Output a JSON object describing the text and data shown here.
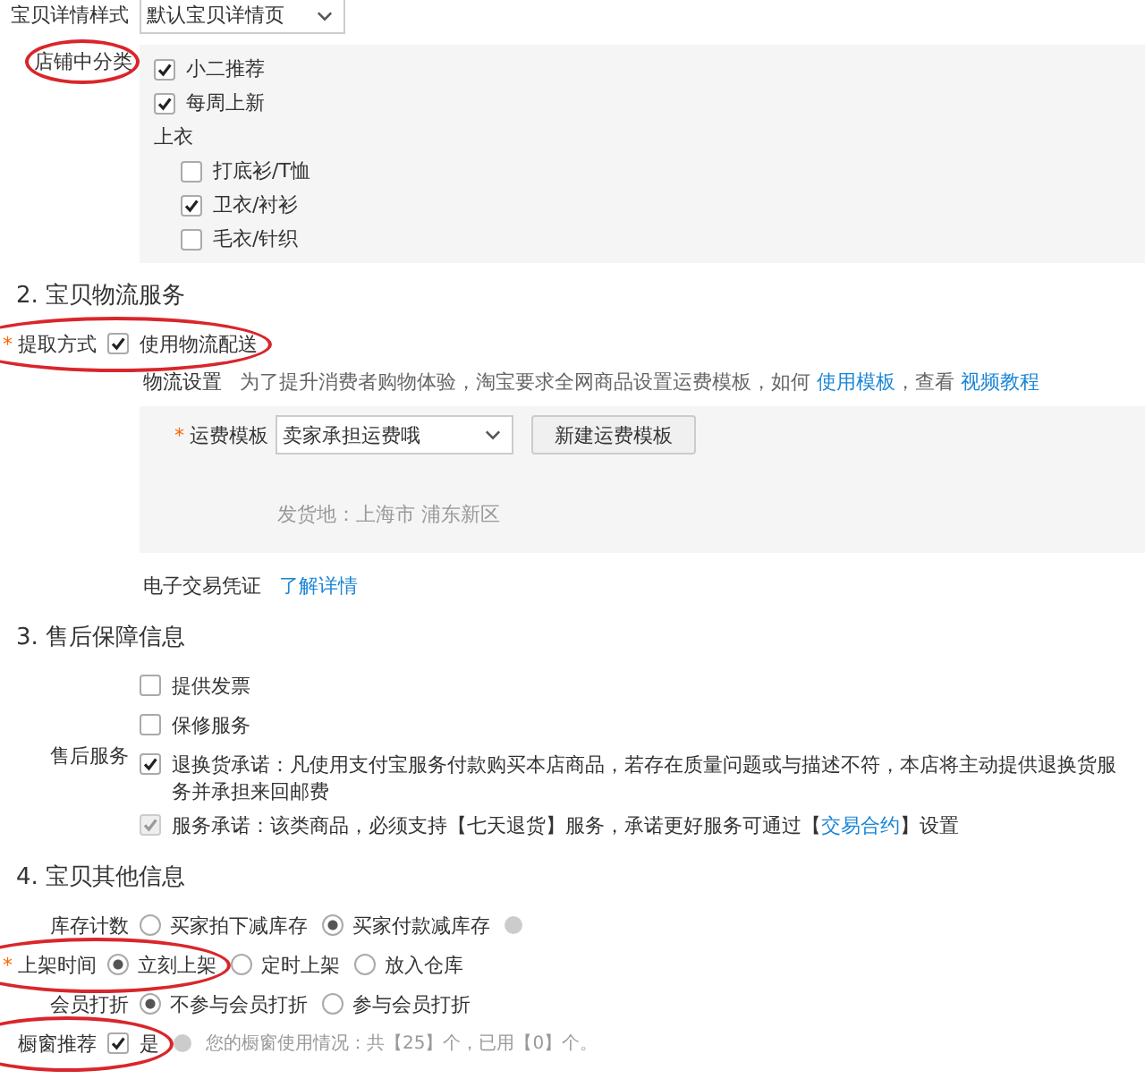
{
  "detail_style": {
    "label": "宝贝详情样式",
    "value": "默认宝贝详情页"
  },
  "shop_category": {
    "label": "店铺中分类",
    "circled": true,
    "items": [
      {
        "kind": "check",
        "label": "小二推荐",
        "checked": true
      },
      {
        "kind": "check",
        "label": "每周上新",
        "checked": true
      },
      {
        "kind": "group",
        "label": "上衣",
        "children": [
          {
            "kind": "check",
            "label": "打底衫/T恤",
            "checked": false
          },
          {
            "kind": "check",
            "label": "卫衣/衬衫",
            "checked": true
          },
          {
            "kind": "check",
            "label": "毛衣/针织",
            "checked": false
          }
        ]
      }
    ]
  },
  "sections": [
    {
      "heading": "2. 宝贝物流服务",
      "rows": [
        {
          "kind": "checks",
          "label": "提取方式",
          "required_mark": "*",
          "circled": true,
          "options": [
            {
              "label": "使用物流配送",
              "checked": true,
              "disabled": false
            }
          ]
        },
        {
          "kind": "note",
          "label": "物流设置",
          "parts": [
            {
              "text": "为了提升消费者购物体验，淘宝要求全网商品设置运费模板，如何 "
            },
            {
              "link": "使用模板"
            },
            {
              "text": "，查看 "
            },
            {
              "link": "视频教程"
            }
          ]
        },
        {
          "kind": "freight",
          "label": "运费模板",
          "required_mark": "*",
          "value": "卖家承担运费哦",
          "button": "新建运费模板",
          "origin": "发货地：上海市 浦东新区"
        },
        {
          "kind": "link",
          "label": "电子交易凭证",
          "link": "了解详情"
        }
      ]
    },
    {
      "heading": "3. 售后保障信息",
      "rows": [
        {
          "kind": "checklist",
          "label": "售后服务",
          "options": [
            {
              "label": "提供发票",
              "checked": false
            },
            {
              "label": "保修服务",
              "checked": false
            },
            {
              "label": "退换货承诺：凡使用支付宝服务付款购买本店商品，若存在质量问题或与描述不符，本店将主动提供退换货服务并承担来回邮费",
              "checked": true
            },
            {
              "label": "服务承诺：该类商品，必须支持【七天退货】服务，承诺更好服务可通过【",
              "link": "交易合约",
              "suffix": "】设置",
              "checked": true,
              "disabled": true
            }
          ]
        }
      ]
    },
    {
      "heading": "4. 宝贝其他信息",
      "rows": [
        {
          "kind": "radios",
          "label": "库存计数",
          "help": true,
          "options": [
            {
              "label": "买家拍下减库存",
              "selected": false
            },
            {
              "label": "买家付款减库存",
              "selected": true
            }
          ]
        },
        {
          "kind": "radios",
          "label": "上架时间",
          "required_mark": "*",
          "circled": true,
          "options": [
            {
              "label": "立刻上架",
              "selected": true
            },
            {
              "label": "定时上架",
              "selected": false
            },
            {
              "label": "放入仓库",
              "selected": false
            }
          ]
        },
        {
          "kind": "radios",
          "label": "会员打折",
          "options": [
            {
              "label": "不参与会员打折",
              "selected": true
            },
            {
              "label": "参与会员打折",
              "selected": false
            }
          ]
        },
        {
          "kind": "checks",
          "label": "橱窗推荐",
          "circled": true,
          "help": true,
          "note": "您的橱窗使用情况：共【25】个，已用【0】个。",
          "options": [
            {
              "label": "是",
              "checked": true,
              "disabled": false
            }
          ]
        }
      ]
    }
  ]
}
